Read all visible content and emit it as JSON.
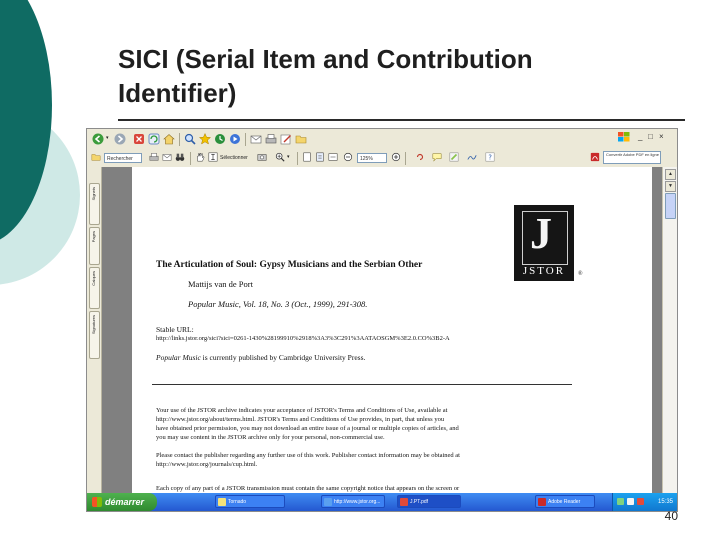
{
  "slide": {
    "title_line1": "SICI (Serial Item and Contribution",
    "title_line2": "Identifier)",
    "page_number": "40",
    "accent_color": "#0f6b63",
    "accent_light": "#d8eeec"
  },
  "browser": {
    "address_value": "Rechercher",
    "zoom_value": "125%",
    "find_label": "Rechercher",
    "adobe_button": "Convertir Adobe PDF en ligne",
    "sidebar_tabs": [
      "Signets",
      "Pages",
      "Calques",
      "Signatures"
    ]
  },
  "document": {
    "logo_text": "JSTOR",
    "reg_mark": "®",
    "article_title": "The Articulation of Soul: Gypsy Musicians and the Serbian Other",
    "author": "Mattijs van de Port",
    "citation": "Popular Music, Vol. 18, No. 3 (Oct., 1999), 291-308.",
    "stable_url_label": "Stable URL:",
    "stable_url": "http://links.jstor.org/sici?sici=0261-1430%28199910%2918%3A3%3C291%3AATAOSGM%3E2.0.CO%3B2-A",
    "publisher_journal": "Popular Music",
    "publisher_text": " is currently published by Cambridge University Press.",
    "terms_lines": [
      "Your use of the JSTOR archive indicates your acceptance of JSTOR's Terms and Conditions of Use, available at",
      "http://www.jstor.org/about/terms.html. JSTOR's Terms and Conditions of Use provides, in part, that unless you",
      "have obtained prior permission, you may not download an entire issue of a journal or multiple copies of articles, and",
      "you may use content in the JSTOR archive only for your personal, non-commercial use."
    ],
    "contact_lines": [
      "Please contact the publisher regarding any further use of this work. Publisher contact information may be obtained at",
      "http://www.jstor.org/journals/cup.html."
    ],
    "cutoff_line": "Each copy of any part of a JSTOR transmission must contain the same copyright notice that appears on the screen or"
  },
  "taskbar": {
    "start_label": "démarrer",
    "windows": [
      "Tornado",
      "http://www.jstor.org...",
      "J.PT.pdf",
      "Adobe Reader"
    ],
    "clock": "15:35"
  }
}
